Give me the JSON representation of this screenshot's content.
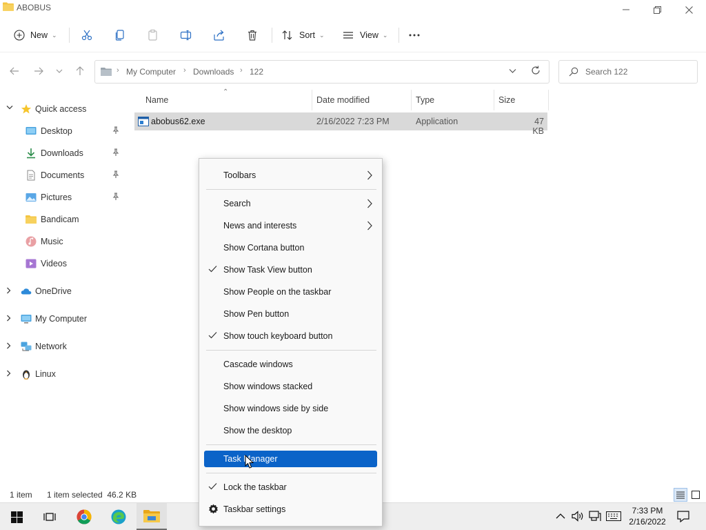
{
  "window": {
    "title": "ABOBUS"
  },
  "toolbar": {
    "new_label": "New",
    "sort_label": "Sort",
    "view_label": "View"
  },
  "address": {
    "crumbs": [
      "My Computer",
      "Downloads",
      "122"
    ],
    "search_placeholder": "Search 122"
  },
  "sidebar": {
    "quick_access": "Quick access",
    "items": [
      {
        "label": "Desktop",
        "icon": "desktop-icon",
        "pinned": true
      },
      {
        "label": "Downloads",
        "icon": "downloads-icon",
        "pinned": true
      },
      {
        "label": "Documents",
        "icon": "documents-icon",
        "pinned": true
      },
      {
        "label": "Pictures",
        "icon": "pictures-icon",
        "pinned": true
      },
      {
        "label": "Bandicam",
        "icon": "folder-icon",
        "pinned": false
      },
      {
        "label": "Music",
        "icon": "music-icon",
        "pinned": false
      },
      {
        "label": "Videos",
        "icon": "videos-icon",
        "pinned": false
      }
    ],
    "onedrive": "OneDrive",
    "my_computer": "My Computer",
    "network": "Network",
    "linux": "Linux"
  },
  "columns": {
    "name": "Name",
    "date": "Date modified",
    "type": "Type",
    "size": "Size"
  },
  "files": [
    {
      "name": "abobus62.exe",
      "date": "2/16/2022 7:23 PM",
      "type": "Application",
      "size": "47 KB",
      "selected": true
    }
  ],
  "status": {
    "count": "1 item",
    "selection": "1 item selected  46.2 KB"
  },
  "context_menu": {
    "toolbars": "Toolbars",
    "search": "Search",
    "news": "News and interests",
    "cortana": "Show Cortana button",
    "task_view": "Show Task View button",
    "people": "Show People on the taskbar",
    "pen": "Show Pen button",
    "touch_keyboard": "Show touch keyboard button",
    "cascade": "Cascade windows",
    "stacked": "Show windows stacked",
    "side_by_side": "Show windows side by side",
    "desktop": "Show the desktop",
    "task_manager": "Task Manager",
    "lock": "Lock the taskbar",
    "settings": "Taskbar settings"
  },
  "taskbar": {
    "time": "7:33 PM",
    "date": "2/16/2022"
  },
  "colors": {
    "accent": "#0b63c8",
    "selection_row": "#d9d9d9",
    "folder": "#f4c542"
  }
}
